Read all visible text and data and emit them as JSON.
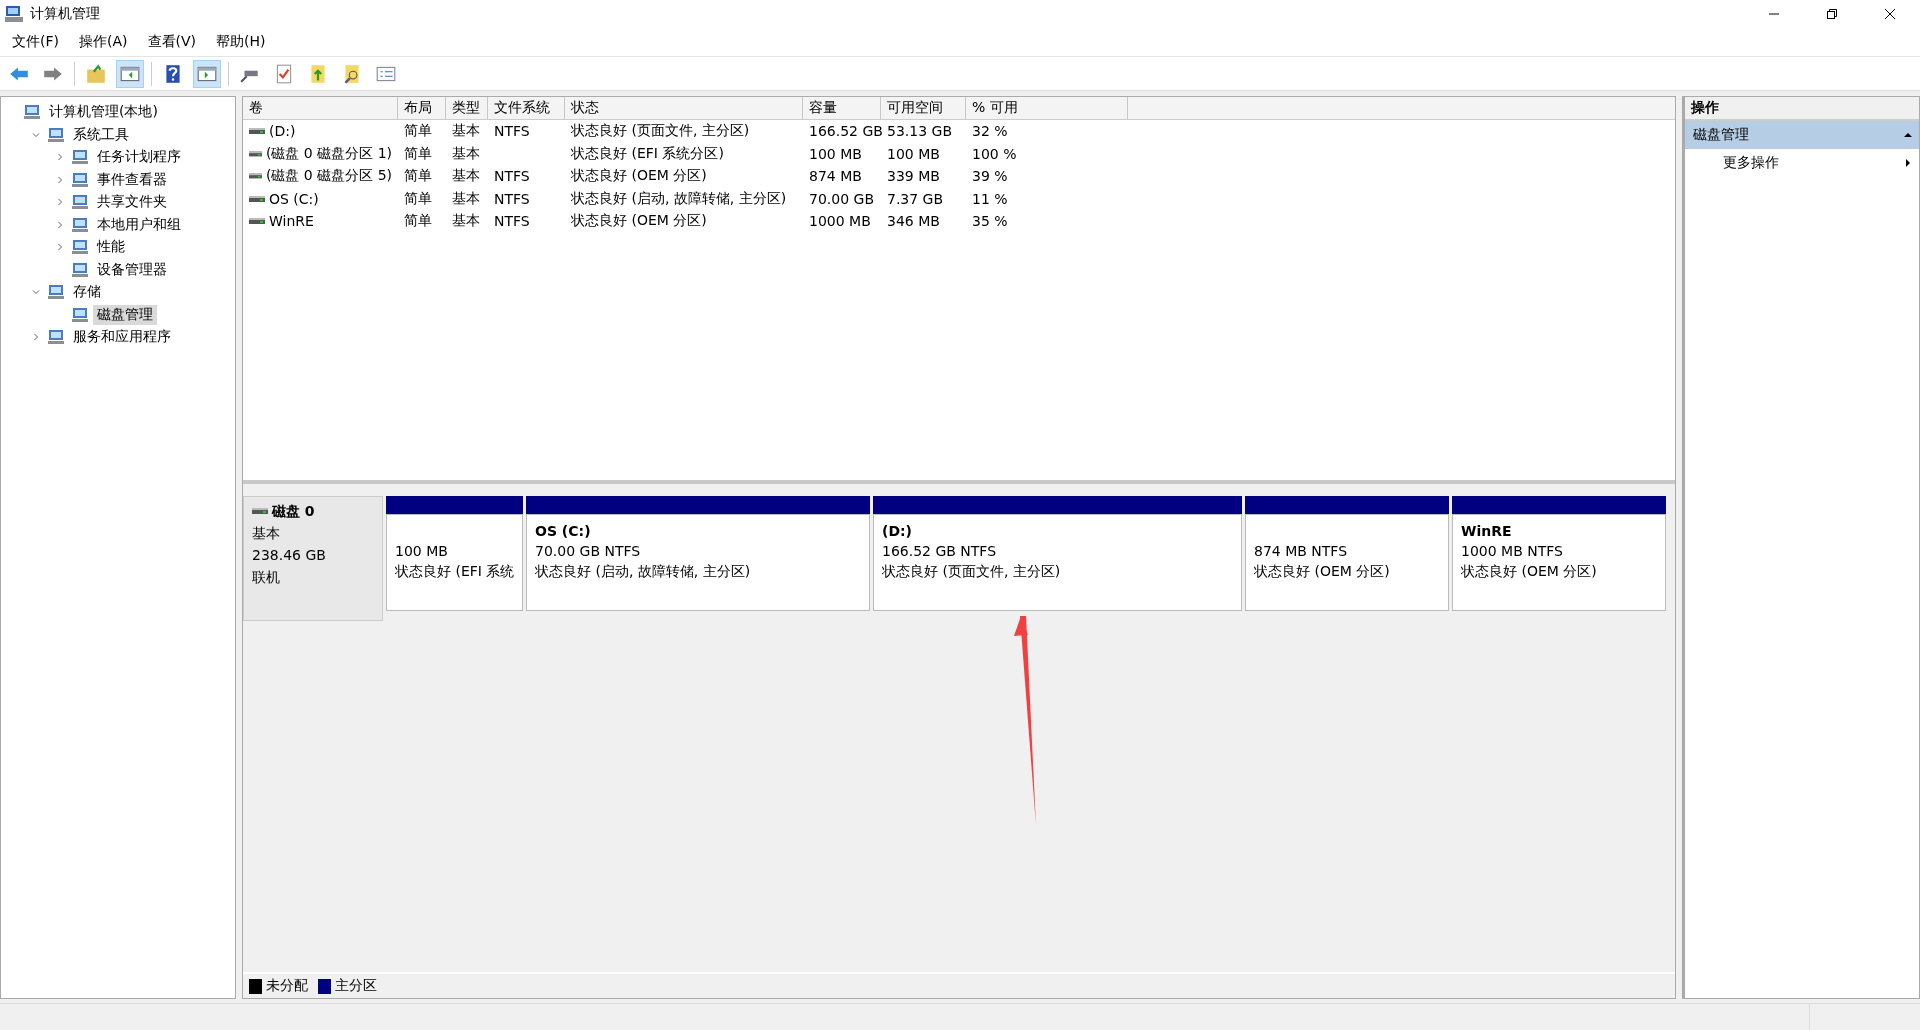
{
  "window": {
    "title": "计算机管理"
  },
  "menu": [
    "文件(F)",
    "操作(A)",
    "查看(V)",
    "帮助(H)"
  ],
  "tree": [
    {
      "label": "计算机管理(本地)",
      "selected": false,
      "children": [
        {
          "label": "系统工具",
          "selected": false,
          "expanded": true,
          "children": [
            {
              "label": "任务计划程序",
              "selected": false,
              "expanded": false
            },
            {
              "label": "事件查看器",
              "selected": false,
              "expanded": false
            },
            {
              "label": "共享文件夹",
              "selected": false,
              "expanded": false
            },
            {
              "label": "本地用户和组",
              "selected": false,
              "expanded": false
            },
            {
              "label": "性能",
              "selected": false,
              "expanded": false
            },
            {
              "label": "设备管理器",
              "selected": false
            }
          ]
        },
        {
          "label": "存储",
          "selected": false,
          "expanded": true,
          "children": [
            {
              "label": "磁盘管理",
              "selected": true
            }
          ]
        },
        {
          "label": "服务和应用程序",
          "selected": false,
          "expanded": false
        }
      ]
    }
  ],
  "table": {
    "columns": [
      "卷",
      "布局",
      "类型",
      "文件系统",
      "状态",
      "容量",
      "可用空间",
      "% 可用"
    ],
    "rows": [
      {
        "volume": "(D:)",
        "layout": "简单",
        "type": "基本",
        "filesystem": "NTFS",
        "status": "状态良好 (页面文件, 主分区)",
        "capacity": "166.52 GB",
        "free": "53.13 GB",
        "percent": "32 %"
      },
      {
        "volume": "(磁盘 0 磁盘分区 1)",
        "layout": "简单",
        "type": "基本",
        "status": "状态良好 (EFI 系统分区)",
        "capacity": "100 MB",
        "free": "100 MB",
        "percent": "100 %"
      },
      {
        "volume": "(磁盘 0 磁盘分区 5)",
        "layout": "简单",
        "type": "基本",
        "filesystem": "NTFS",
        "status": "状态良好 (OEM 分区)",
        "capacity": "874 MB",
        "free": "339 MB",
        "percent": "39 %"
      },
      {
        "volume": "OS (C:)",
        "layout": "简单",
        "type": "基本",
        "filesystem": "NTFS",
        "status": "状态良好 (启动, 故障转储, 主分区)",
        "capacity": "70.00 GB",
        "free": "7.37 GB",
        "percent": "11 %"
      },
      {
        "volume": "WinRE",
        "layout": "简单",
        "type": "基本",
        "filesystem": "NTFS",
        "status": "状态良好 (OEM 分区)",
        "capacity": "1000 MB",
        "free": "346 MB",
        "percent": "35 %"
      }
    ]
  },
  "disk": {
    "name": "磁盘 0",
    "type": "基本",
    "size": "238.46 GB",
    "state": "联机",
    "partitions": [
      {
        "size": "100 MB",
        "status": "状态良好 (EFI 系统",
        "color": "#000080"
      },
      {
        "title": "OS  (C:)",
        "size": "70.00 GB NTFS",
        "status": "状态良好 (启动, 故障转储, 主分区)",
        "color": "#000080"
      },
      {
        "title": "(D:)",
        "size": "166.52 GB NTFS",
        "status": "状态良好 (页面文件, 主分区)",
        "color": "#000080"
      },
      {
        "size": "874 MB NTFS",
        "status": "状态良好 (OEM 分区)",
        "color": "#000080"
      },
      {
        "title": "WinRE",
        "size": "1000 MB NTFS",
        "status": "状态良好 (OEM 分区)",
        "color": "#000080"
      }
    ]
  },
  "legend": [
    {
      "label": "未分配",
      "color": "#000000"
    },
    {
      "label": "主分区",
      "color": "#000080"
    }
  ],
  "actions": {
    "header": "操作",
    "section": {
      "label": "磁盘管理",
      "expanded": true
    },
    "items": [
      "更多操作"
    ]
  }
}
